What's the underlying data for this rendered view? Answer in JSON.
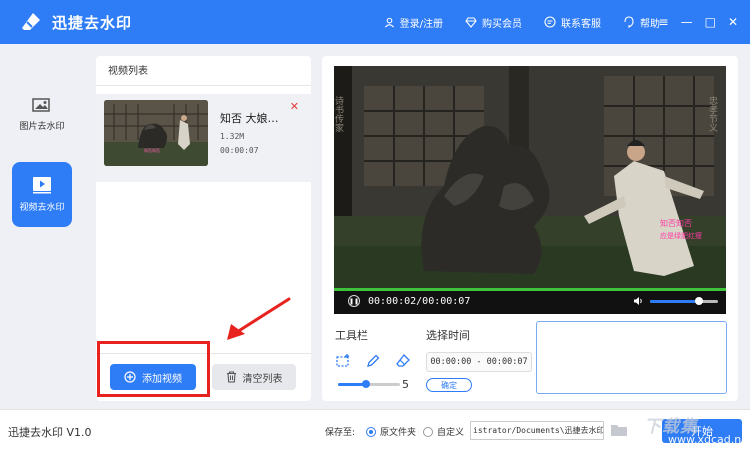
{
  "app": {
    "title": "迅捷去水印"
  },
  "top_links": [
    {
      "label": "登录/注册",
      "icon": "user-icon"
    },
    {
      "label": "购买会员",
      "icon": "diamond-icon"
    },
    {
      "label": "联系客服",
      "icon": "chat-icon"
    },
    {
      "label": "帮助",
      "icon": "help-icon"
    }
  ],
  "window_controls": {
    "menu": "≡",
    "minimize": "—",
    "maximize": "□",
    "close": "✕"
  },
  "sidebar": {
    "items": [
      {
        "label": "图片去水印",
        "icon": "image-icon",
        "active": false
      },
      {
        "label": "视频去水印",
        "icon": "video-icon",
        "active": true
      }
    ]
  },
  "video_list": {
    "title": "视频列表",
    "items": [
      {
        "name": "知否 大娘…",
        "size": "1.32M",
        "duration": "00:00:07"
      }
    ],
    "add_button": "添加视频",
    "clear_button": "清空列表"
  },
  "player": {
    "timecode": "00:00:02/00:00:07",
    "progress": 0.29,
    "volume": 0.72
  },
  "tools": {
    "label": "工具栏",
    "size_value": "5",
    "size_level": 0.45
  },
  "time_select": {
    "label": "选择时间",
    "range": "00:00:00 - 00:00:07",
    "confirm": "确定"
  },
  "status": {
    "version": "迅捷去水印 V1.0",
    "save_label": "保存至:",
    "options": [
      "原文件夹",
      "自定义"
    ],
    "selected": "原文件夹",
    "path": "istrator/Documents\\迅捷去水印",
    "start": "开始"
  },
  "watermark": {
    "line1": "下载集",
    "line2": "www.xdcad.net"
  },
  "colors": {
    "accent": "#2f7df6",
    "highlight": "#e8231f",
    "progress": "#3cc43c"
  }
}
